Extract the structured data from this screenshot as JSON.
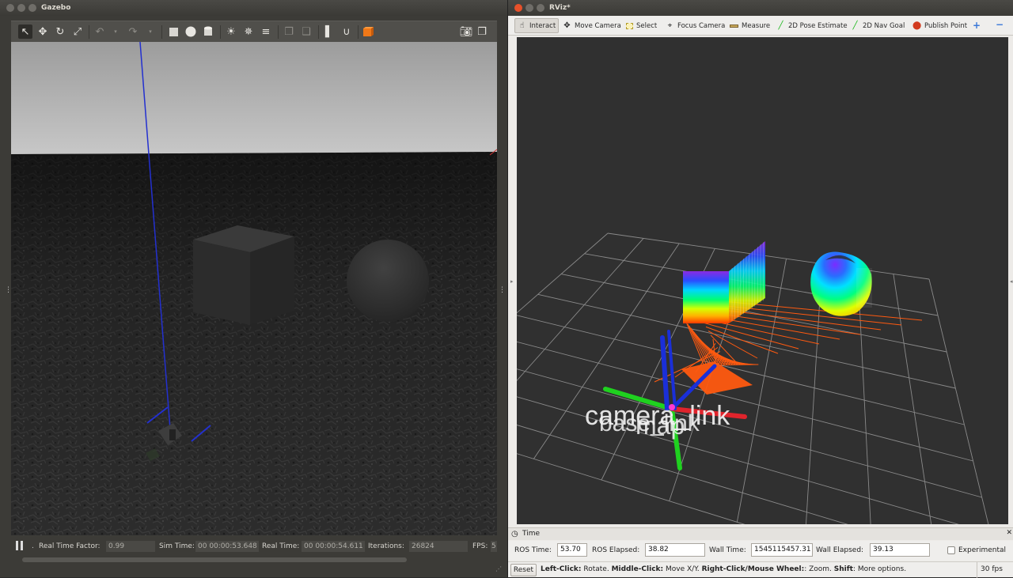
{
  "gazebo": {
    "window_title": "Gazebo",
    "toolbar_icons": [
      "select-icon",
      "translate-icon",
      "rotate-icon",
      "scale-icon",
      "undo-icon",
      "undo-menu-icon",
      "redo-icon",
      "redo-menu-icon",
      "box-icon",
      "sphere-icon",
      "cylinder-icon",
      "point-light-icon",
      "spot-light-icon",
      "directional-light-icon",
      "copy-icon",
      "paste-icon",
      "align-icon",
      "snap-icon",
      "view-angle-icon",
      "screenshot-icon"
    ],
    "status": {
      "real_time_factor_label": "Real Time Factor:",
      "real_time_factor": "0.99",
      "sim_time_label": "Sim Time:",
      "sim_time": "00 00:00:53.648",
      "real_time_label": "Real Time:",
      "real_time": "00 00:00:54.611",
      "iterations_label": "Iterations:",
      "iterations": "26824",
      "fps_label": "FPS:",
      "fps": "5"
    }
  },
  "rviz": {
    "window_title": "RViz*",
    "tools": [
      {
        "label": "Interact",
        "icon": "interact-icon",
        "active": true
      },
      {
        "label": "Move Camera",
        "icon": "move-camera-icon"
      },
      {
        "label": "Select",
        "icon": "select-box-icon"
      },
      {
        "label": "Focus Camera",
        "icon": "focus-camera-icon"
      },
      {
        "label": "Measure",
        "icon": "ruler-icon"
      },
      {
        "label": "2D Pose Estimate",
        "icon": "pose-estimate-icon"
      },
      {
        "label": "2D Nav Goal",
        "icon": "nav-goal-icon"
      },
      {
        "label": "Publish Point",
        "icon": "map-pin-icon"
      }
    ],
    "scene_labels": [
      "camera_link",
      "base_link",
      "map"
    ],
    "time_panel": {
      "title": "Time",
      "ros_time_label": "ROS Time:",
      "ros_time": "53.70",
      "ros_elapsed_label": "ROS Elapsed:",
      "ros_elapsed": "38.82",
      "wall_time_label": "Wall Time:",
      "wall_time": "1545115457.31",
      "wall_elapsed_label": "Wall Elapsed:",
      "wall_elapsed": "39.13",
      "experimental_label": "Experimental"
    },
    "hint": {
      "reset_label": "Reset",
      "left_click": "Left-Click:",
      "left_click_desc": " Rotate. ",
      "middle_click": "Middle-Click:",
      "middle_click_desc": " Move X/Y. ",
      "right_click": "Right-Click/Mouse Wheel:",
      "right_click_desc": ": Zoom. ",
      "shift": "Shift",
      "shift_desc": ": More options.",
      "fps": "30 fps"
    },
    "colors": {
      "x_axis": "#e0242c",
      "y_axis": "#1fd11f",
      "z_axis": "#1a2fd8",
      "laser": "#ff5a10"
    }
  }
}
